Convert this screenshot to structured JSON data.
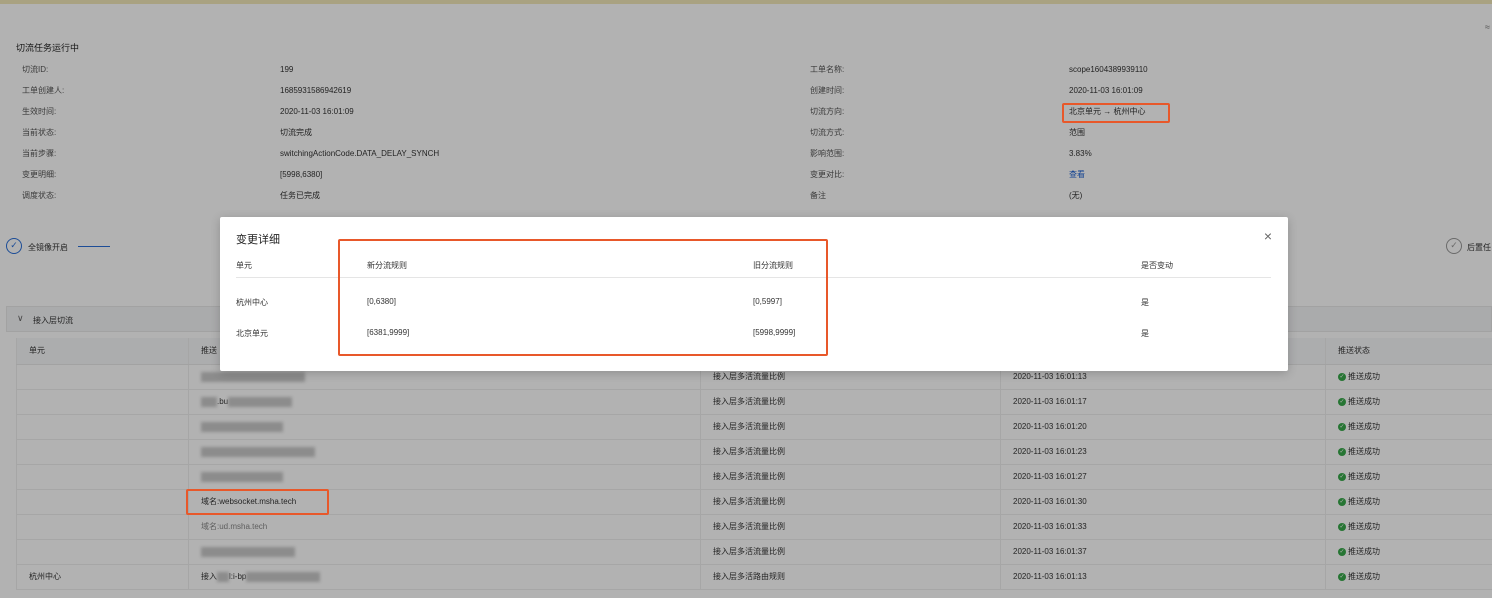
{
  "header": {
    "corner_text": "≈"
  },
  "task": {
    "title": "切流任务运行中",
    "left_fields": [
      {
        "label": "切流ID:",
        "value": "199"
      },
      {
        "label": "工单创建人:",
        "value": "1685931586942619"
      },
      {
        "label": "生效时间:",
        "value": "2020-11-03 16:01:09"
      },
      {
        "label": "当前状态:",
        "value": "切流完成"
      },
      {
        "label": "当前步骤:",
        "value": "switchingActionCode.DATA_DELAY_SYNCH"
      },
      {
        "label": "变更明细:",
        "value": "[5998,6380]"
      },
      {
        "label": "调度状态:",
        "value": "任务已完成"
      }
    ],
    "right_fields": [
      {
        "label": "工单名称:",
        "value": "scope1604389939110"
      },
      {
        "label": "创建时间:",
        "value": "2020-11-03 16:01:09"
      },
      {
        "label": "切流方向:",
        "value": "北京单元 → 杭州中心"
      },
      {
        "label": "切流方式:",
        "value": "范围"
      },
      {
        "label": "影响范围:",
        "value": "3.83%"
      },
      {
        "label": "变更对比:",
        "value": "查看"
      },
      {
        "label": "备注",
        "value": "(无)"
      }
    ]
  },
  "steps": {
    "first_label": "全镜像开启",
    "last_label": "后置任"
  },
  "section": {
    "title": "接入层切流"
  },
  "table": {
    "headers": [
      "单元",
      "推送",
      "",
      "",
      "推送状态"
    ],
    "rows": [
      {
        "unit": "",
        "target": "",
        "rule": "接入层多活流量比例",
        "time": "2020-11-03 16:01:13",
        "status": "推送成功"
      },
      {
        "unit": "",
        "target": ".bu",
        "rule": "接入层多活流量比例",
        "time": "2020-11-03 16:01:17",
        "status": "推送成功"
      },
      {
        "unit": "",
        "target": "",
        "rule": "接入层多活流量比例",
        "time": "2020-11-03 16:01:20",
        "status": "推送成功"
      },
      {
        "unit": "",
        "target": "",
        "rule": "接入层多活流量比例",
        "time": "2020-11-03 16:01:23",
        "status": "推送成功"
      },
      {
        "unit": "",
        "target": "",
        "rule": "接入层多活流量比例",
        "time": "2020-11-03 16:01:27",
        "status": "推送成功"
      },
      {
        "unit": "",
        "target": "域名:websocket.msha.tech",
        "rule": "接入层多活流量比例",
        "time": "2020-11-03 16:01:30",
        "status": "推送成功"
      },
      {
        "unit": "",
        "target": "域名:ud.msha.tech",
        "rule": "接入层多活流量比例",
        "time": "2020-11-03 16:01:33",
        "status": "推送成功"
      },
      {
        "unit": "",
        "target": "",
        "rule": "接入层多活流量比例",
        "time": "2020-11-03 16:01:37",
        "status": "推送成功"
      },
      {
        "unit": "杭州中心",
        "target": "接入",
        "target_tail": "l:i-bp",
        "rule": "接入层多活路由规则",
        "time": "2020-11-03 16:01:13",
        "status": "推送成功"
      }
    ]
  },
  "modal": {
    "title": "变更详细",
    "close_icon": "×",
    "headers": [
      "单元",
      "新分流规则",
      "旧分流规则",
      "是否变动"
    ],
    "rows": [
      {
        "unit": "杭州中心",
        "new_rule": "[0,6380]",
        "old_rule": "[0,5997]",
        "changed": "是"
      },
      {
        "unit": "北京单元",
        "new_rule": "[6381,9999]",
        "old_rule": "[5998,9999]",
        "changed": "是"
      }
    ]
  },
  "colors": {
    "highlight": "#e8582a",
    "link": "#1a5fd0",
    "success": "#37a84a"
  }
}
